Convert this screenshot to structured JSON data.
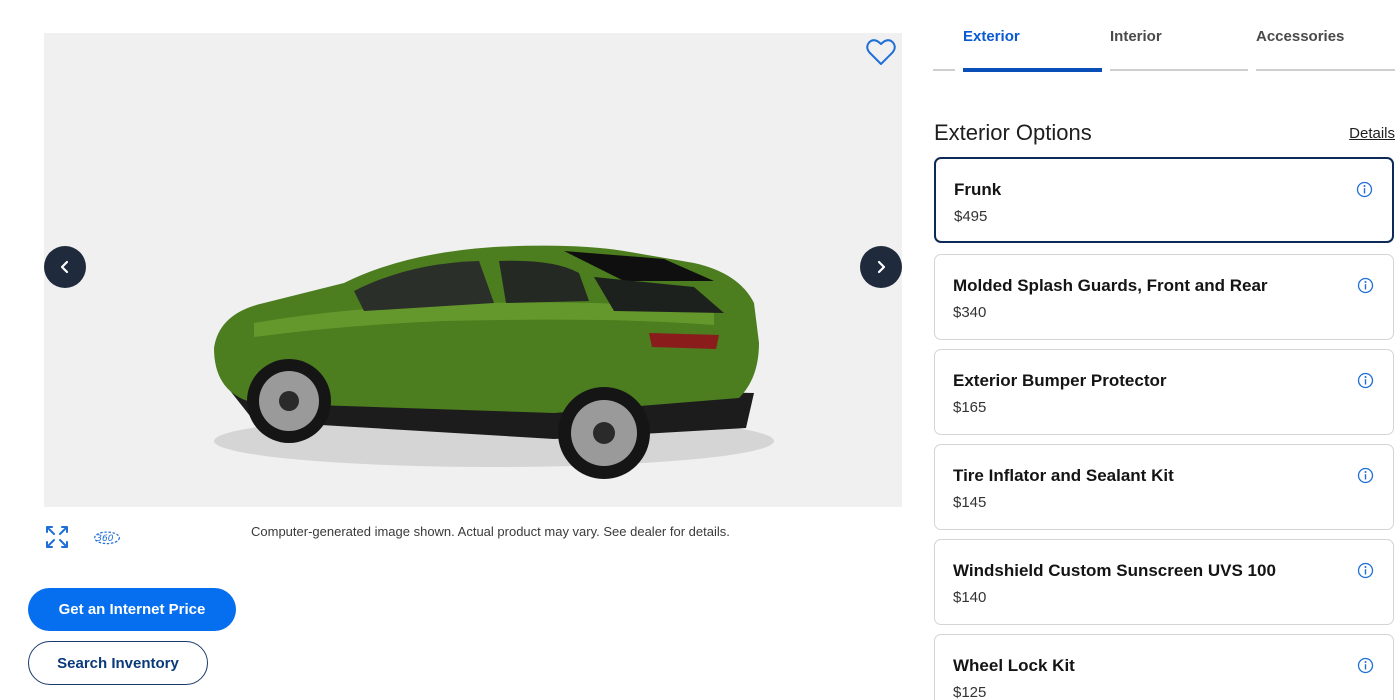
{
  "viewer": {
    "disclaimer": "Computer-generated image shown. Actual product may vary. See dealer for details.",
    "vehicle_color": "#4a7a1c"
  },
  "actions": {
    "internet_price_label": "Get an Internet Price",
    "search_inventory_label": "Search Inventory"
  },
  "tabs": [
    {
      "label": "Exterior",
      "active": true
    },
    {
      "label": "Interior",
      "active": false
    },
    {
      "label": "Accessories",
      "active": false
    }
  ],
  "options": {
    "title": "Exterior Options",
    "details_label": "Details",
    "items": [
      {
        "name": "Frunk",
        "price": "$495",
        "selected": true
      },
      {
        "name": "Molded Splash Guards, Front and Rear",
        "price": "$340",
        "selected": false
      },
      {
        "name": "Exterior Bumper Protector",
        "price": "$165",
        "selected": false
      },
      {
        "name": "Tire Inflator and Sealant Kit",
        "price": "$145",
        "selected": false
      },
      {
        "name": "Windshield Custom Sunscreen UVS 100",
        "price": "$140",
        "selected": false
      },
      {
        "name": "Wheel Lock Kit",
        "price": "$125",
        "selected": false
      }
    ]
  },
  "colors": {
    "primary_button": "#066fef",
    "active_tab": "#0a5ad4",
    "nav_arrow_bg": "#1f2a3d",
    "info_icon": "#1f6fd6"
  },
  "icons": {
    "favorite": "heart-icon",
    "prev": "chevron-left-icon",
    "next": "chevron-right-icon",
    "expand": "expand-arrows-icon",
    "rotate": "360-view-icon",
    "info": "info-circle-icon"
  }
}
